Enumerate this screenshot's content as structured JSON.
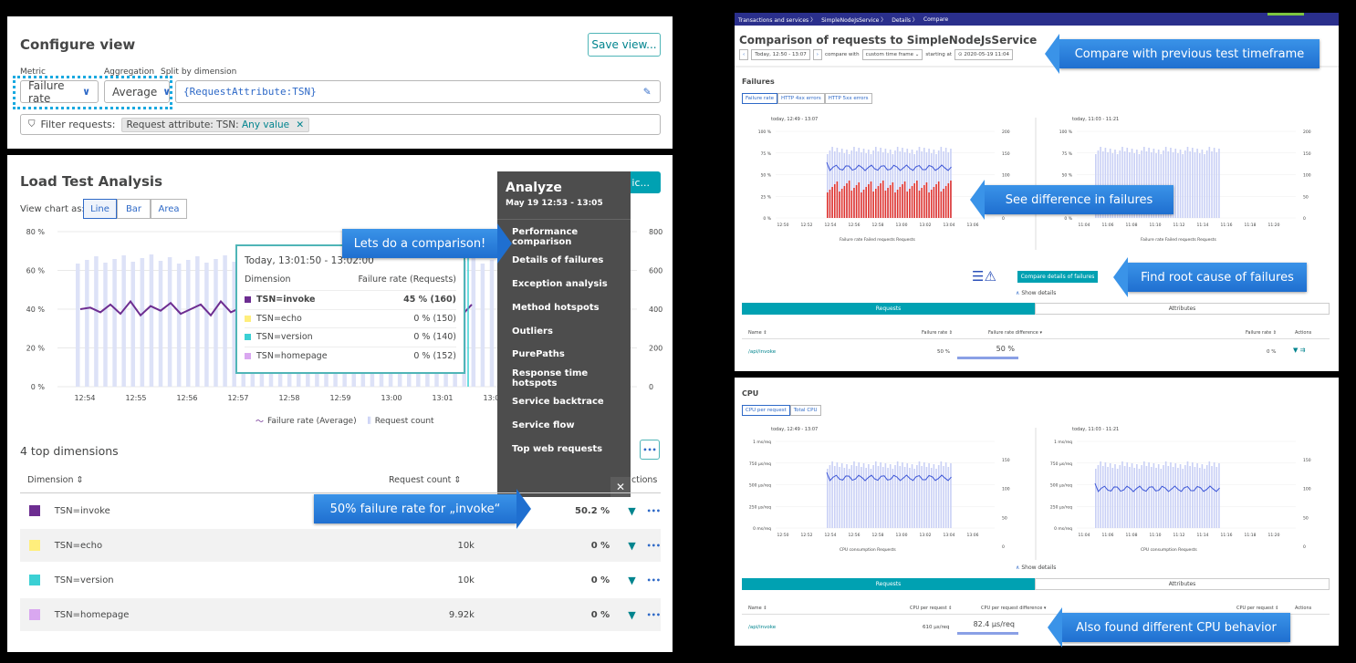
{
  "left": {
    "configure_title": "Configure view",
    "save_view": "Save view...",
    "metric_label": "Metric",
    "aggregation_label": "Aggregation",
    "split_label": "Split by dimension",
    "metric_value": "Failure rate",
    "aggregation_value": "Average",
    "split_value": "{RequestAttribute:TSN}",
    "filter_label": "Filter requests:",
    "filter_chip_prefix": "Request attribute: TSN:",
    "filter_chip_value": "Any value",
    "lta_title": "Load Test Analysis",
    "analyze_btn_partial": "ic...",
    "view_chart_as": "View chart as:",
    "view_tabs": [
      "Line",
      "Bar",
      "Area"
    ],
    "y_left": [
      "80 %",
      "60 %",
      "40 %",
      "20 %",
      "0 %"
    ],
    "y_right": [
      "800",
      "600",
      "400",
      "200",
      "0"
    ],
    "x_ticks": [
      "12:54",
      "12:55",
      "12:56",
      "12:57",
      "12:58",
      "12:59",
      "13:00",
      "13:01",
      "13:02"
    ],
    "legend_line": "Failure rate (Average)",
    "legend_bar": "Request count",
    "tooltip": {
      "title": "Today, 13:01:50 - 13:02:00",
      "col_dimension": "Dimension",
      "col_value": "Failure rate (Requests)",
      "rows": [
        {
          "name": "TSN=invoke",
          "value": "45 % (160)",
          "color": "#6d2d91"
        },
        {
          "name": "TSN=echo",
          "value": "0 % (150)",
          "color": "#ffee7c"
        },
        {
          "name": "TSN=version",
          "value": "0 % (140)",
          "color": "#3bd0d4"
        },
        {
          "name": "TSN=homepage",
          "value": "0 % (152)",
          "color": "#d9a7f0"
        }
      ]
    },
    "analyze_menu": {
      "title": "Analyze",
      "subtitle": "May 19 12:53 - 13:05",
      "items": [
        "Performance comparison",
        "Details of failures",
        "Exception analysis",
        "Method hotspots",
        "Outliers",
        "PurePaths",
        "Response time hotspots",
        "Service backtrace",
        "Service flow",
        "Top web requests"
      ],
      "close": "✕"
    },
    "top_dimensions_title": "4 top dimensions",
    "col_dimension": "Dimension ⇕",
    "col_request_count": "Request count ⇕",
    "col_actions_partial": "ctions",
    "more": "•••",
    "rows": [
      {
        "name": "TSN=invoke",
        "count": "",
        "rate": "50.2 %",
        "color": "#6d2d91"
      },
      {
        "name": "TSN=echo",
        "count": "10k",
        "rate": "0 %",
        "color": "#ffee7c"
      },
      {
        "name": "TSN=version",
        "count": "10k",
        "rate": "0 %",
        "color": "#3bd0d4"
      },
      {
        "name": "TSN=homepage",
        "count": "9.92k",
        "rate": "0 %",
        "color": "#d9a7f0"
      }
    ]
  },
  "callouts": {
    "comparison": "Lets do a comparison!",
    "invoke": "50% failure rate for „invoke“",
    "previous": "Compare with previous test timeframe",
    "failures": "See difference in failures",
    "root": "Find root cause of failures",
    "cpu": "Also found different CPU behavior"
  },
  "right_top": {
    "breadcrumbs": [
      "Transactions and services",
      "SimpleNodeJsService",
      "Details",
      "Compare"
    ],
    "title": "Comparison of requests to SimpleNodeJsService",
    "timeframe": "Today, 12:50 - 13:07",
    "compare_with": "compare with",
    "custom": "custom time frame",
    "starting_at": "starting at",
    "start_date": "2020-05-19 11:04",
    "failures_title": "Failures",
    "tabs": [
      "Failure rate",
      "HTTP 4xx errors",
      "HTTP 5xx errors"
    ],
    "left_chart_title": "today, 12:49 - 13:07",
    "right_chart_title": "today, 11:03 - 11:21",
    "y_left": [
      "100 %",
      "75 %",
      "50 %",
      "25 %",
      "0 %"
    ],
    "y_right": [
      "200",
      "150",
      "100",
      "50",
      "0"
    ],
    "x_left": [
      "12:50",
      "12:52",
      "12:54",
      "12:56",
      "12:58",
      "13:00",
      "13:02",
      "13:04",
      "13:06"
    ],
    "x_right": [
      "11:04",
      "11:06",
      "11:08",
      "11:10",
      "11:12",
      "11:14",
      "11:16",
      "11:18",
      "11:20"
    ],
    "legend": [
      "Failure rate",
      "Failed requests",
      "Requests"
    ],
    "compare_details": "Compare details of failures",
    "show_details": "Show details",
    "bottom_tabs": [
      "Requests",
      "Attributes"
    ],
    "table_headers": [
      "Name ⇕",
      "Failure rate ⇕",
      "Failure rate difference ▾",
      "Failure rate ⇕",
      "Actions"
    ],
    "table_row": [
      "/api/invoke",
      "50 %",
      "50 %",
      "0 %"
    ]
  },
  "right_bottom": {
    "cpu_title": "CPU",
    "tabs": [
      "CPU per request",
      "Total CPU"
    ],
    "left_chart_title": "today, 12:49 - 13:07",
    "right_chart_title": "today, 11:03 - 11:21",
    "y_left": [
      "1 ms/req",
      "750 µs/req",
      "500 µs/req",
      "250 µs/req",
      "0 ms/req"
    ],
    "y_right": [
      "150",
      "100",
      "50",
      "0"
    ],
    "x_left": [
      "12:50",
      "12:52",
      "12:54",
      "12:56",
      "12:58",
      "13:00",
      "13:02",
      "13:04",
      "13:06"
    ],
    "x_right": [
      "11:04",
      "11:06",
      "11:08",
      "11:10",
      "11:12",
      "11:14",
      "11:16",
      "11:18",
      "11:20"
    ],
    "legend": [
      "CPU consumption",
      "Requests"
    ],
    "show_details": "Show details",
    "bottom_tabs": [
      "Requests",
      "Attributes"
    ],
    "table_headers": [
      "Name ⇕",
      "CPU per request ⇕",
      "CPU per request difference ▾",
      "CPU per request ⇕",
      "Actions"
    ],
    "table_row": [
      "/api/invoke",
      "610 µs/req",
      "82.4 µs/req"
    ]
  },
  "colors": {
    "teal": "#00a1b2",
    "blue": "#2e69c7",
    "purple": "#6d2d91",
    "bar": "#dde2f7",
    "red": "#e0342f",
    "menu": "#4d4d4d"
  }
}
